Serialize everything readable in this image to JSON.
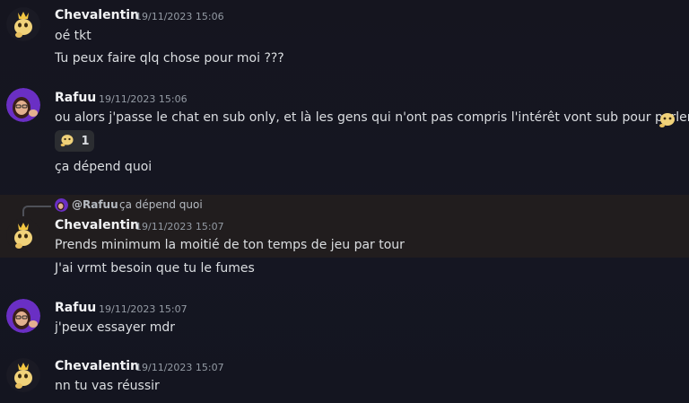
{
  "messages": [
    {
      "author": "Chevalentin",
      "timestamp": "19/11/2023 15:06",
      "lines": [
        "oé tkt",
        "Tu peux faire qlq chose pour moi ???"
      ]
    },
    {
      "author": "Rafuu",
      "timestamp": "19/11/2023 15:06",
      "lines": [
        "ou alors j'passe le chat en sub only, et là les gens qui n'ont pas compris l'intérêt vont sub pour parler",
        "ça dépend quoi"
      ],
      "reaction": {
        "icon": "shrug-emoji-icon",
        "count": "1"
      }
    },
    {
      "author": "Chevalentin",
      "timestamp": "19/11/2023 15:07",
      "reply": {
        "mention": "@Rafuu",
        "text": "ça dépend quoi"
      },
      "lines": [
        "Prends minimum la moitié de ton temps de jeu par tour",
        "J'ai vrmt besoin que tu le fumes"
      ]
    },
    {
      "author": "Rafuu",
      "timestamp": "19/11/2023 15:07",
      "lines": [
        "j'peux essayer mdr"
      ]
    },
    {
      "author": "Chevalentin",
      "timestamp": "19/11/2023 15:07",
      "lines": [
        "nn tu vas réussir"
      ]
    }
  ],
  "colors": {
    "background": "#141520",
    "highlight": "#211d1e",
    "author": "#f2f3f5",
    "timestamp": "#949ba4",
    "text": "#dbdee1"
  }
}
